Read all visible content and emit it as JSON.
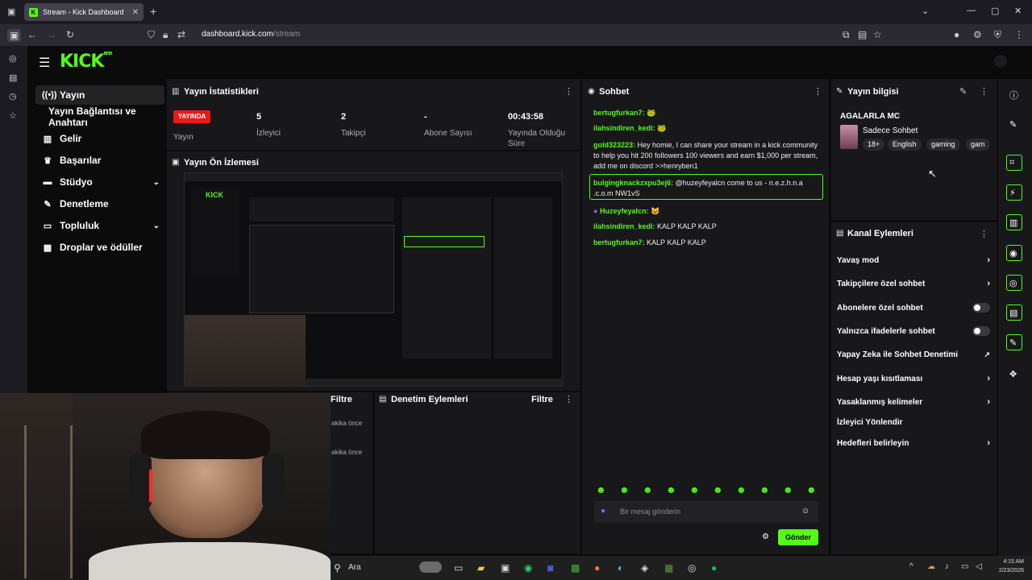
{
  "browser": {
    "tab_title": "Stream - Kick Dashboard",
    "url_domain": "dashboard.kick.com",
    "url_path": "/stream"
  },
  "brand": {
    "logo": "KICK",
    "logo_sup": "BETA"
  },
  "nav": {
    "items": [
      {
        "label": "Yayın",
        "icon": "broadcast-icon"
      },
      {
        "label": "Yayın Bağlantısı ve Anahtarı",
        "icon": ""
      },
      {
        "label": "Gelir",
        "icon": "chart-icon"
      },
      {
        "label": "Başarılar",
        "icon": "trophy-icon"
      },
      {
        "label": "Stüdyo",
        "icon": "studio-icon"
      },
      {
        "label": "Denetleme",
        "icon": "wrench-icon"
      },
      {
        "label": "Topluluk",
        "icon": "community-icon"
      },
      {
        "label": "Droplar ve ödüller",
        "icon": "gift-icon"
      }
    ]
  },
  "stats": {
    "title": "Yayın İstatistikleri",
    "live_badge": "YAYINDA",
    "items": [
      {
        "value": "",
        "label": "Yayın"
      },
      {
        "value": "5",
        "label": "İzleyici"
      },
      {
        "value": "2",
        "label": "Takipçi"
      },
      {
        "value": "-",
        "label": "Abone Sayısı"
      },
      {
        "value": "00:43:58",
        "label": "Yayında Olduğu Süre"
      }
    ]
  },
  "preview": {
    "title": "Yayın Ön İzlemesi"
  },
  "mod_actions": {
    "title": "Denetim Eylemleri",
    "filter": "Filtre",
    "left_filter": "Filtre",
    "time1": "akika önce",
    "time2": "akika önce"
  },
  "chat": {
    "title": "Sohbet",
    "messages": [
      {
        "user": "bertugfurkan7:",
        "text": "",
        "color": "#53fc18"
      },
      {
        "user": "ilahsindiren_kedi:",
        "text": "",
        "color": "#53fc18"
      },
      {
        "user": "gold323223:",
        "text": "Hey homie, I can share your stream in a kick community to help you hit 200 followers 100 viewers and earn $1,000 per stream, add me on discord >>henryben1",
        "color": "#53fc18"
      },
      {
        "user": "bulgingknackzxpu3ej6:",
        "text": "@huzeyfeyalcn come to us - n.e.z.h.n.a .c.o.m NW1vS",
        "color": "#53fc18"
      },
      {
        "user": "Huzeyfeyalcn:",
        "text": "",
        "color": "#53fc18"
      },
      {
        "user": "ilahsindiren_kedi:",
        "text": "KALP KALP KALP",
        "color": "#53fc18"
      },
      {
        "user": "bertugfurkan7:",
        "text": "KALP KALP KALP",
        "color": "#53fc18"
      }
    ],
    "input_placeholder": "Bir mesaj gönderin",
    "send_label": "Gönder"
  },
  "stream_info": {
    "title": "Yayın bilgisi",
    "stream_title": "AGALARLA MC",
    "category": "Sadece Sohbet",
    "tags": [
      "18+",
      "English",
      "gaming",
      "gam"
    ]
  },
  "channel_actions": {
    "title": "Kanal Eylemleri",
    "items": [
      {
        "label": "Yavaş mod",
        "control": "chevron"
      },
      {
        "label": "Takipçilere özel sohbet",
        "control": "chevron"
      },
      {
        "label": "Abonelere özel sohbet",
        "control": "toggle"
      },
      {
        "label": "Yalnızca ifadelerle sohbet",
        "control": "toggle"
      },
      {
        "label": "Yapay Zeka ile Sohbet Denetimi",
        "control": "external"
      },
      {
        "label": "Hesap yaşı kısıtlaması",
        "control": "chevron"
      },
      {
        "label": "Yasaklanmış kelimeler",
        "control": "chevron"
      },
      {
        "label": "İzleyici Yönlendir",
        "control": "none"
      },
      {
        "label": "Hedefleri belirleyin",
        "control": "chevron"
      }
    ]
  },
  "taskbar": {
    "search": "Ara",
    "time": "4:15 AM",
    "date": "2/23/2026"
  },
  "colors": {
    "accent": "#53fc18",
    "live": "#e91916",
    "panel": "#18181b"
  }
}
